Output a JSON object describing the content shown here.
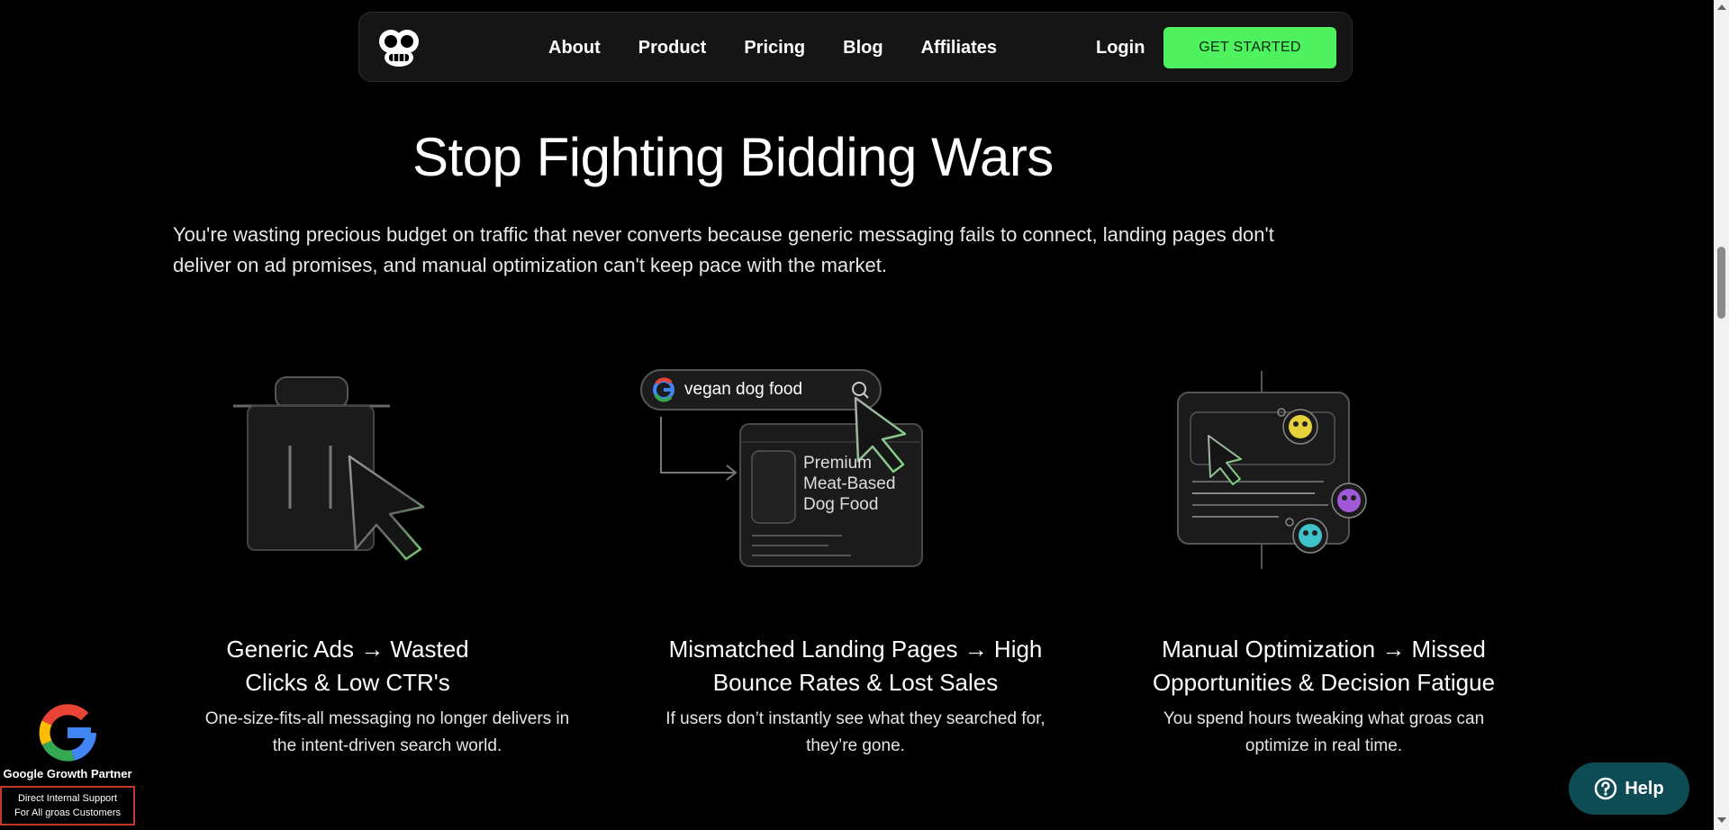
{
  "nav": {
    "links": [
      "About",
      "Product",
      "Pricing",
      "Blog",
      "Affiliates"
    ],
    "login": "Login",
    "cta": "GET STARTED"
  },
  "hero": {
    "title": "Stop Fighting Bidding Wars",
    "subtitle": "You're wasting precious budget on traffic that never converts because generic messaging fails to connect, landing pages don't deliver on ad promises, and manual optimization can't keep pace with the market."
  },
  "illustrations": {
    "search_query": "vegan dog food",
    "landing_text": [
      "Premium",
      "Meat-Based",
      "Dog Food"
    ]
  },
  "cards": [
    {
      "title_lines": [
        "Generic Ads → Wasted",
        "Clicks & Low CTR's"
      ],
      "desc_lines": [
        "One-size-fits-all messaging no longer delivers in",
        "the intent-driven search world."
      ]
    },
    {
      "title_lines": [
        "Mismatched Landing Pages → High",
        "Bounce Rates & Lost Sales"
      ],
      "desc_lines": [
        "If users don’t instantly see what they searched for,",
        "they’re gone."
      ]
    },
    {
      "title_lines": [
        "Manual Optimization → Missed",
        "Opportunities & Decision Fatigue"
      ],
      "desc_lines": [
        "You spend hours tweaking what groas can",
        "optimize in real time."
      ]
    }
  ],
  "google_badge": {
    "label": "Google Growth Partner",
    "box_lines": [
      "Direct Internal Support",
      "For All groas Customers"
    ]
  },
  "help": {
    "label": "Help"
  },
  "colors": {
    "cta_green": "#4ef25f",
    "help_teal": "#0e4c55",
    "badge_border": "#c0392b",
    "background": "#000000"
  }
}
